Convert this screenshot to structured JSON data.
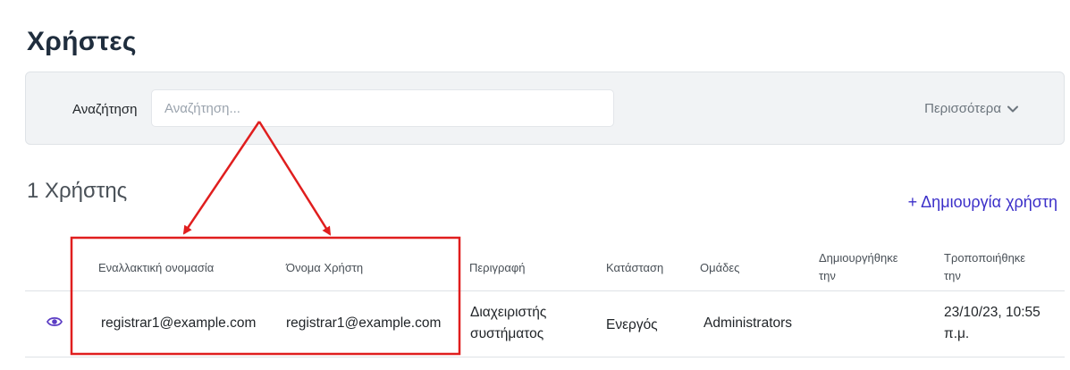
{
  "page": {
    "title": "Χρήστες"
  },
  "search": {
    "label": "Αναζήτηση",
    "placeholder": "Αναζήτηση...",
    "value": "",
    "more_label": "Περισσότερα"
  },
  "results": {
    "count_title": "1 Χρήστης",
    "create_label": "+ Δημιουργία χρήστη"
  },
  "table": {
    "columns": {
      "alias": "Εναλλακτική ονομασία",
      "username": "Όνομα Χρήστη",
      "description": "Περιγραφή",
      "status": "Κατάσταση",
      "groups": "Ομάδες",
      "created_l1": "Δημιουργήθηκε",
      "created_l2": "την",
      "modified_l1": "Τροποποιήθηκε",
      "modified_l2": "την"
    },
    "rows": [
      {
        "alias": "registrar1@example.com",
        "username": "registrar1@example.com",
        "description_l1": "Διαχειριστής",
        "description_l2": "συστήματος",
        "status": "Ενεργός",
        "groups": "Administrators",
        "created": "",
        "modified_l1": "23/10/23, 10:55",
        "modified_l2": "π.μ."
      }
    ]
  },
  "colors": {
    "accent": "#3b2fc9",
    "annotation": "#e01e1e",
    "panel_bg": "#f1f3f5",
    "eye_icon": "#5b3cc4"
  },
  "icons": {
    "view": "eye-icon",
    "more": "chevron-down-icon"
  }
}
